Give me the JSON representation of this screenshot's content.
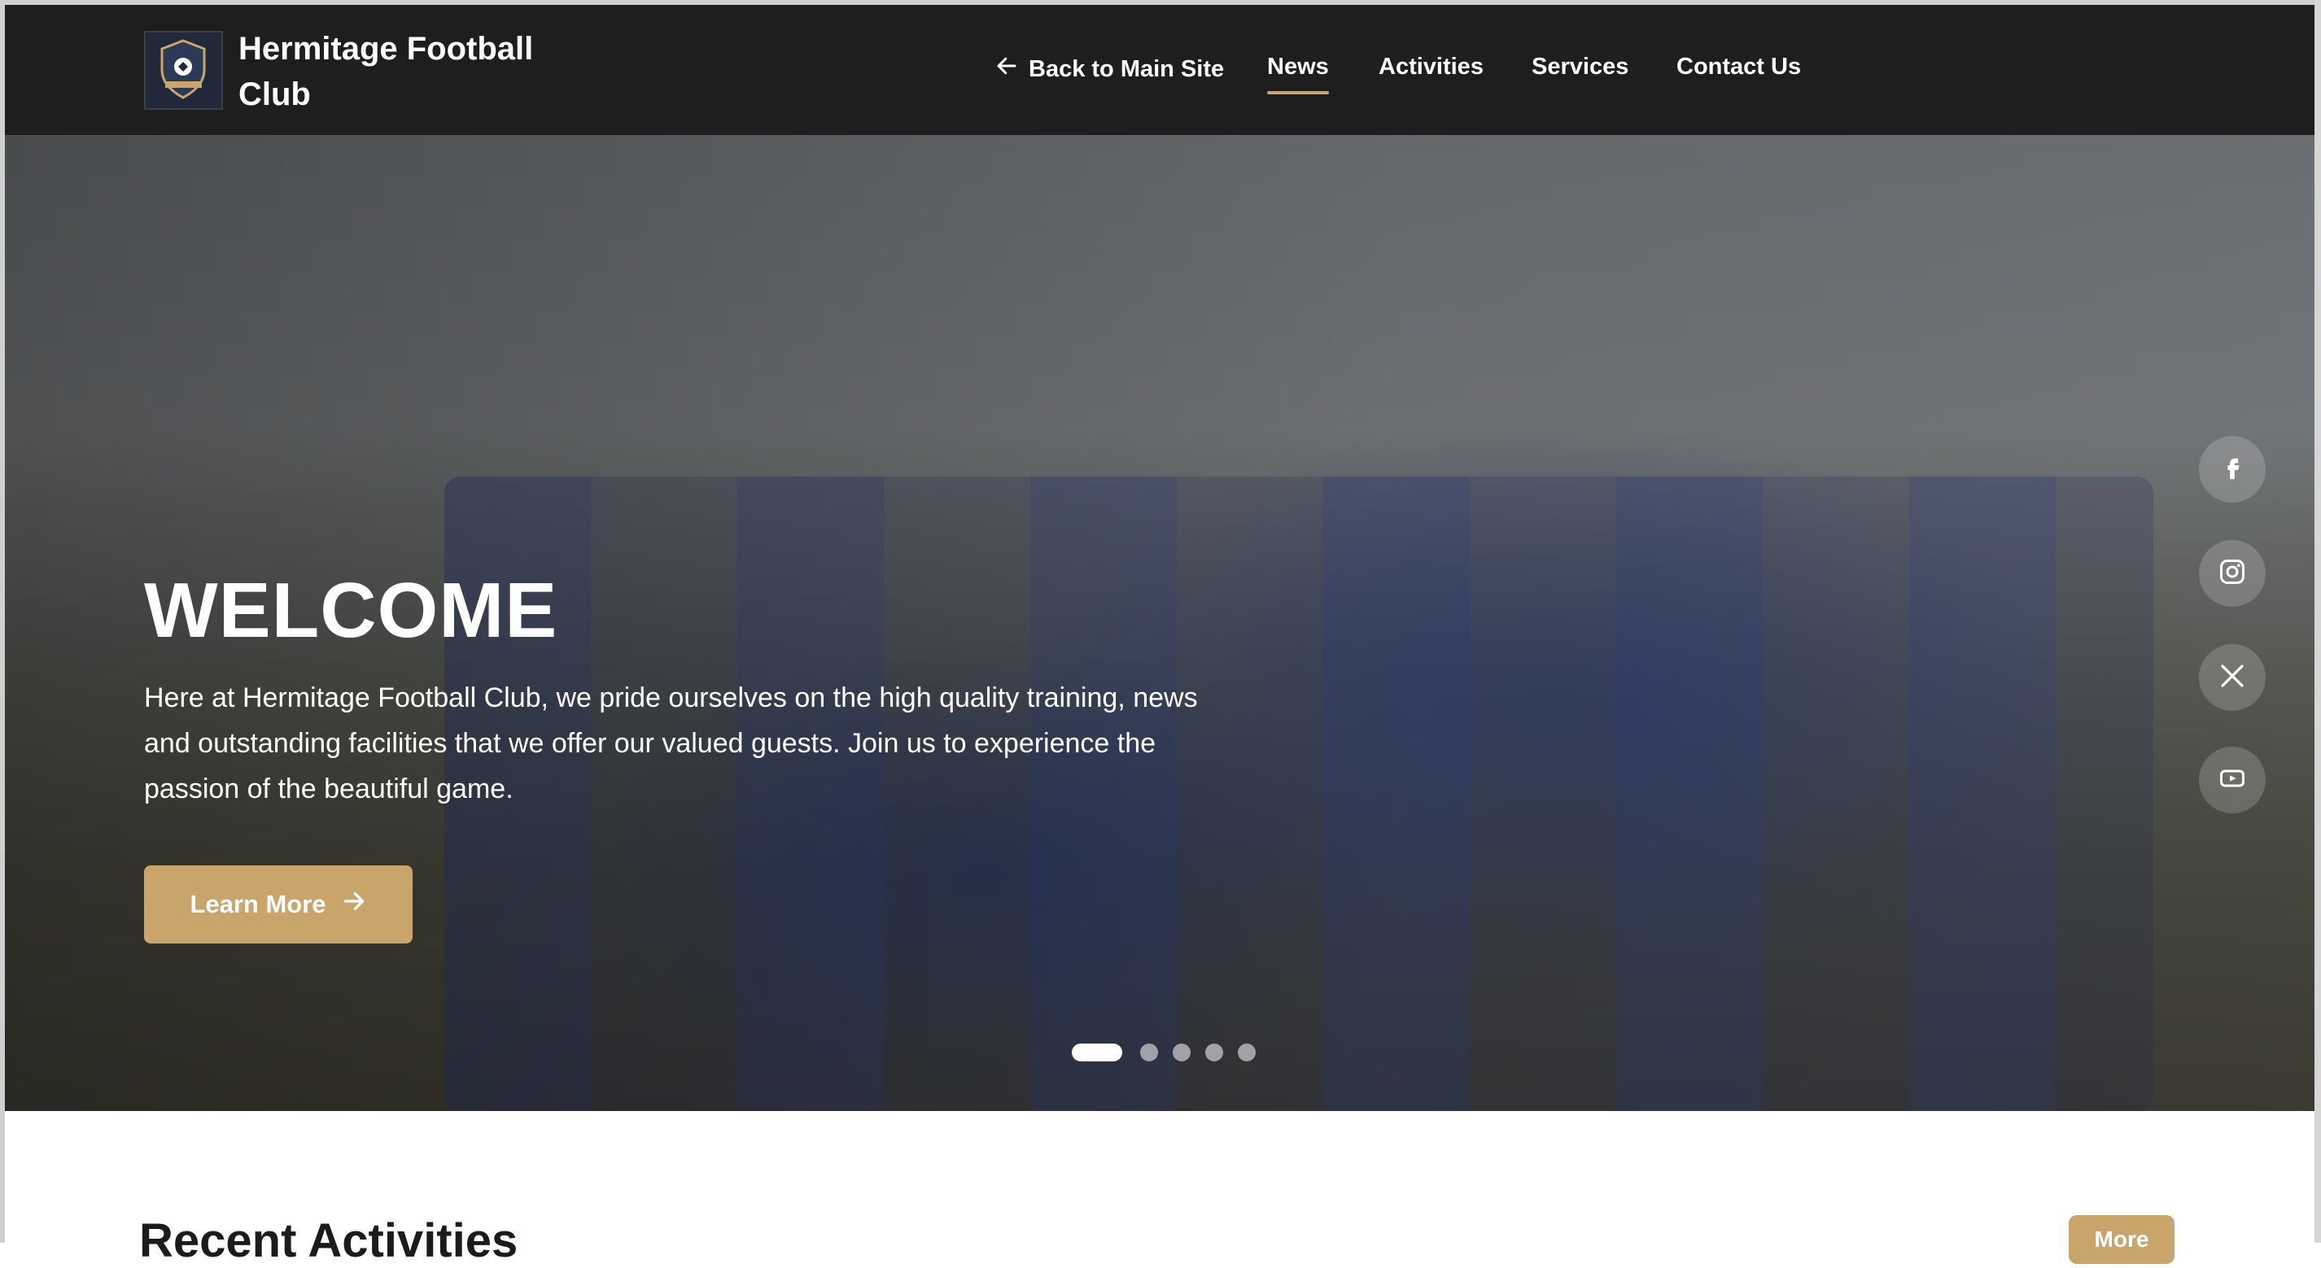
{
  "header": {
    "brand": "Hermitage Football Club",
    "nav": {
      "back_label": "Back to Main Site",
      "items": [
        "News",
        "Activities",
        "Services",
        "Contact Us"
      ],
      "active": "News"
    }
  },
  "hero": {
    "title": "WELCOME",
    "text": "Here at Hermitage Football Club, we pride ourselves on the high quality training, news and outstanding facilities that we offer our valued guests. Join us to experience the passion of the beautiful game.",
    "button_label": "Learn More",
    "slides_count": 5,
    "active_slide": 1
  },
  "social": [
    "facebook-icon",
    "instagram-icon",
    "x-icon",
    "youtube-icon"
  ],
  "recent": {
    "title": "Recent Activities",
    "more_label": "More"
  },
  "colors": {
    "header_bg": "#1e1e1e",
    "accent": "#c9a46b"
  }
}
